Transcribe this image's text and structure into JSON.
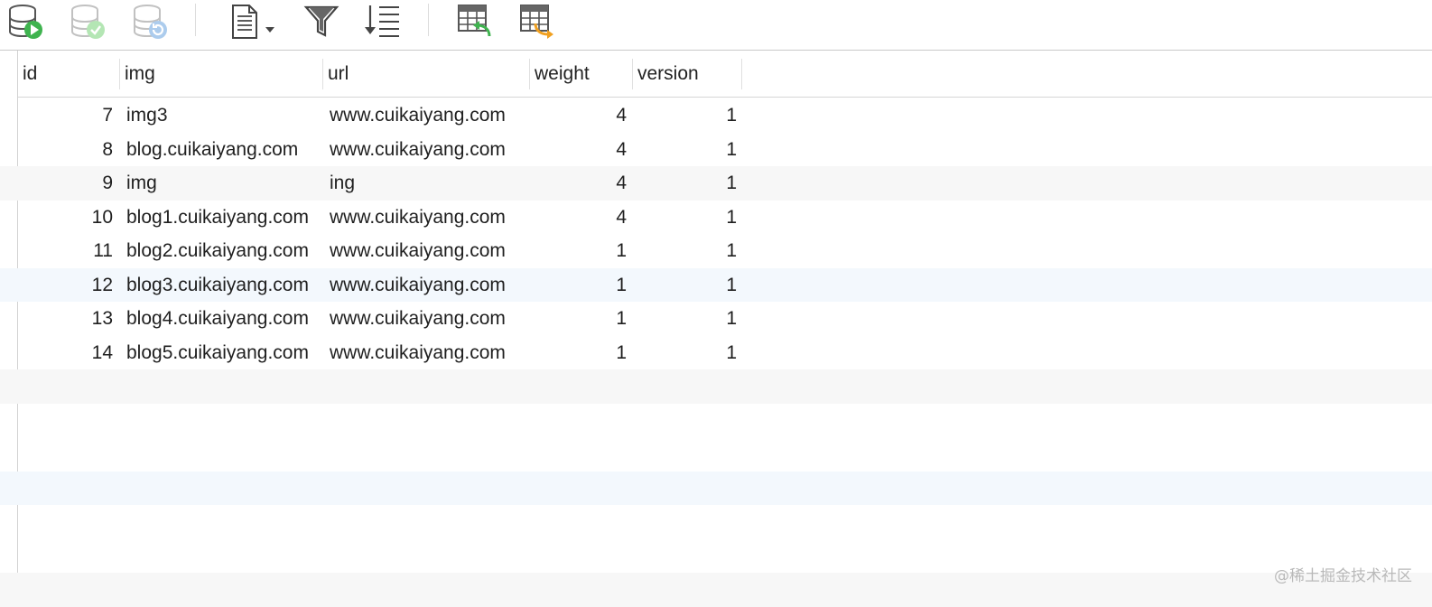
{
  "toolbar": {
    "buttons": [
      {
        "name": "apply-changes-button",
        "icon": "database-run-icon"
      },
      {
        "name": "commit-button",
        "icon": "database-check-icon"
      },
      {
        "name": "rollback-button",
        "icon": "database-refresh-icon"
      },
      {
        "name": "document-menu-button",
        "icon": "document-dropdown-icon"
      },
      {
        "name": "filter-button",
        "icon": "funnel-icon"
      },
      {
        "name": "sort-button",
        "icon": "sort-list-icon"
      },
      {
        "name": "import-button",
        "icon": "table-import-icon"
      },
      {
        "name": "export-button",
        "icon": "table-export-icon"
      }
    ]
  },
  "table": {
    "columns": [
      "id",
      "img",
      "url",
      "weight",
      "version"
    ],
    "rows": [
      {
        "id": "7",
        "img": "img3",
        "url": "www.cuikaiyang.com",
        "weight": "4",
        "version": "1"
      },
      {
        "id": "8",
        "img": "blog.cuikaiyang.com",
        "url": "www.cuikaiyang.com",
        "weight": "4",
        "version": "1"
      },
      {
        "id": "9",
        "img": "img",
        "url": "ing",
        "weight": "4",
        "version": "1"
      },
      {
        "id": "10",
        "img": "blog1.cuikaiyang.com",
        "url": "www.cuikaiyang.com",
        "weight": "4",
        "version": "1"
      },
      {
        "id": "11",
        "img": "blog2.cuikaiyang.com",
        "url": "www.cuikaiyang.com",
        "weight": "1",
        "version": "1"
      },
      {
        "id": "12",
        "img": "blog3.cuikaiyang.com",
        "url": "www.cuikaiyang.com",
        "weight": "1",
        "version": "1"
      },
      {
        "id": "13",
        "img": "blog4.cuikaiyang.com",
        "url": "www.cuikaiyang.com",
        "weight": "1",
        "version": "1"
      },
      {
        "id": "14",
        "img": "blog5.cuikaiyang.com",
        "url": "www.cuikaiyang.com",
        "weight": "1",
        "version": "1"
      }
    ]
  },
  "watermark": "@稀土掘金技术社区",
  "colors": {
    "stripe_gray": "#f7f7f7",
    "stripe_blue": "#f3f8fd",
    "run_green": "#3fb34f",
    "arrow_orange": "#f0a020"
  }
}
